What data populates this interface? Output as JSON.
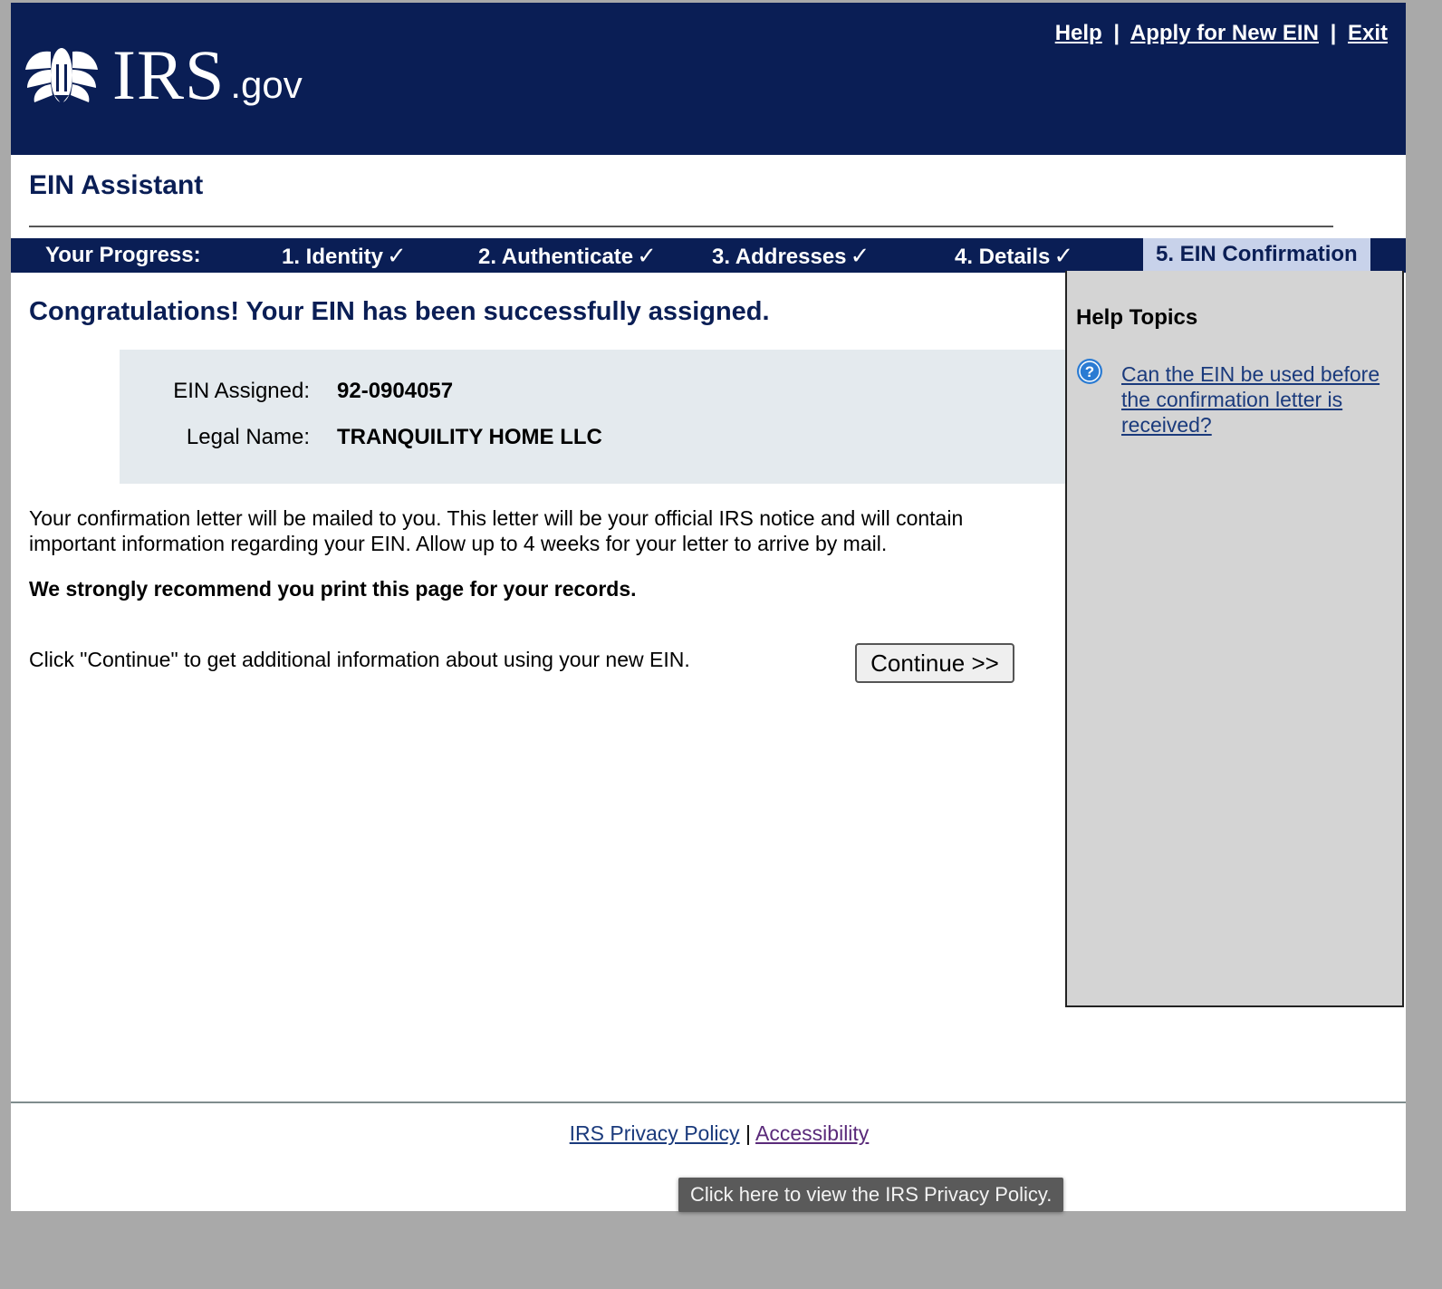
{
  "header": {
    "logo_irs": "IRS",
    "logo_gov": ".gov",
    "links": {
      "help": "Help",
      "apply": "Apply for New EIN",
      "exit": "Exit",
      "separator": "|"
    }
  },
  "app_title": "EIN Assistant",
  "progress": {
    "label": "Your Progress:",
    "steps": [
      {
        "label": "1. Identity",
        "status": "done"
      },
      {
        "label": "2. Authenticate",
        "status": "done"
      },
      {
        "label": "3. Addresses",
        "status": "done"
      },
      {
        "label": "4. Details",
        "status": "done"
      },
      {
        "label": "5. EIN Confirmation",
        "status": "current"
      }
    ],
    "check_glyph": "✓"
  },
  "main": {
    "congrats": "Congratulations! Your EIN has been successfully assigned.",
    "ein": {
      "ein_label": "EIN Assigned:",
      "ein_value": "92-0904057",
      "name_label": "Legal Name:",
      "name_value": "TRANQUILITY HOME LLC"
    },
    "letter_text": "Your confirmation letter will be mailed to you. This letter will be your official IRS notice and will contain important information regarding your EIN. Allow up to 4 weeks for your letter to arrive by mail.",
    "recommend": "We strongly recommend you print this page for your records.",
    "continue_text": "Click \"Continue\" to get additional information about using your new EIN.",
    "continue_button": "Continue >>"
  },
  "help": {
    "title": "Help Topics",
    "topic_link": "Can the EIN be used before the confirmation letter is received?",
    "icon": "question-circle-icon"
  },
  "footer": {
    "privacy": "IRS Privacy Policy",
    "separator": "|",
    "accessibility": "Accessibility"
  },
  "tooltip": "Click here to view the IRS Privacy Policy.",
  "colors": {
    "header_bg": "#0a1e55",
    "current_step_bg": "#c8d2ea",
    "ein_box_bg": "#e4eaee",
    "help_panel_bg": "#d4d4d4",
    "link": "#1a3a7c"
  }
}
